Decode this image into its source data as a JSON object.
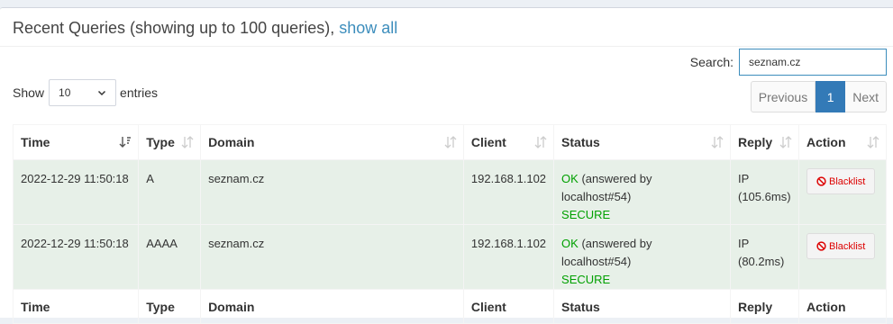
{
  "header": {
    "title": "Recent Queries (showing up to 100 queries), ",
    "show_all": "show all"
  },
  "search": {
    "label": "Search:",
    "value": "seznam.cz"
  },
  "length": {
    "prefix": "Show",
    "value": "10",
    "suffix": "entries"
  },
  "pager": {
    "previous": "Previous",
    "current": "1",
    "next": "Next"
  },
  "columns": [
    "Time",
    "Type",
    "Domain",
    "Client",
    "Status",
    "Reply",
    "Action"
  ],
  "rows": [
    {
      "time": "2022-12-29 11:50:18",
      "type": "A",
      "domain": "seznam.cz",
      "client": "192.168.1.102",
      "status_ok": "OK",
      "status_detail": " (answered by localhost#54)",
      "status_secure": "SECURE",
      "reply_1": "IP",
      "reply_2": "(105.6ms)",
      "action": "Blacklist"
    },
    {
      "time": "2022-12-29 11:50:18",
      "type": "AAAA",
      "domain": "seznam.cz",
      "client": "192.168.1.102",
      "status_ok": "OK",
      "status_detail": " (answered by localhost#54)",
      "status_secure": "SECURE",
      "reply_1": "IP",
      "reply_2": "(80.2ms)",
      "action": "Blacklist"
    }
  ],
  "colors": {
    "link": "#3c8dbc",
    "ok": "#00a000",
    "row_bg": "#e7f0e8",
    "page_active": "#337ab7",
    "danger": "#dd0000"
  },
  "icons": {
    "sort": "sort-arrows-icon",
    "sort_active": "sort-desc-icon",
    "blacklist": "ban-icon",
    "select": "chevron-down-icon"
  }
}
